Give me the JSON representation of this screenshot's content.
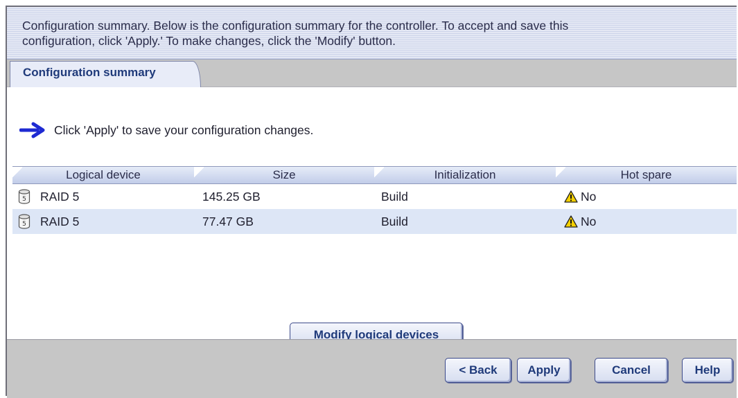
{
  "header": {
    "line1": "Configuration summary. Below is the configuration summary for the controller.  To accept and save this",
    "line2": "configuration, click 'Apply.'  To make changes, click the 'Modify' button."
  },
  "tabs": [
    {
      "label": "Configuration summary",
      "active": true
    }
  ],
  "hint": {
    "icon": "arrow-right-icon",
    "text": "Click 'Apply' to save your configuration changes."
  },
  "table": {
    "columns": [
      "Logical device",
      "Size",
      "Initialization",
      "Hot spare"
    ],
    "rows": [
      {
        "icon": "raid-disk-icon",
        "device": "RAID 5",
        "size": "145.25 GB",
        "initialization": "Build",
        "hotspare_icon": "warning-icon",
        "hotspare": "No"
      },
      {
        "icon": "raid-disk-icon",
        "device": "RAID 5",
        "size": "77.47 GB",
        "initialization": "Build",
        "hotspare_icon": "warning-icon",
        "hotspare": "No"
      }
    ]
  },
  "buttons": {
    "modify": "Modify logical devices",
    "back": "< Back",
    "apply": "Apply",
    "cancel": "Cancel",
    "help": "Help"
  },
  "colors": {
    "accent": "#1f3a7a",
    "header_bg": "#d8def0",
    "row_alt": "#dde6f6",
    "toolbar_gray": "#c6c6c6",
    "arrow_blue": "#1e2ad2",
    "warning_yellow": "#f5d000"
  }
}
